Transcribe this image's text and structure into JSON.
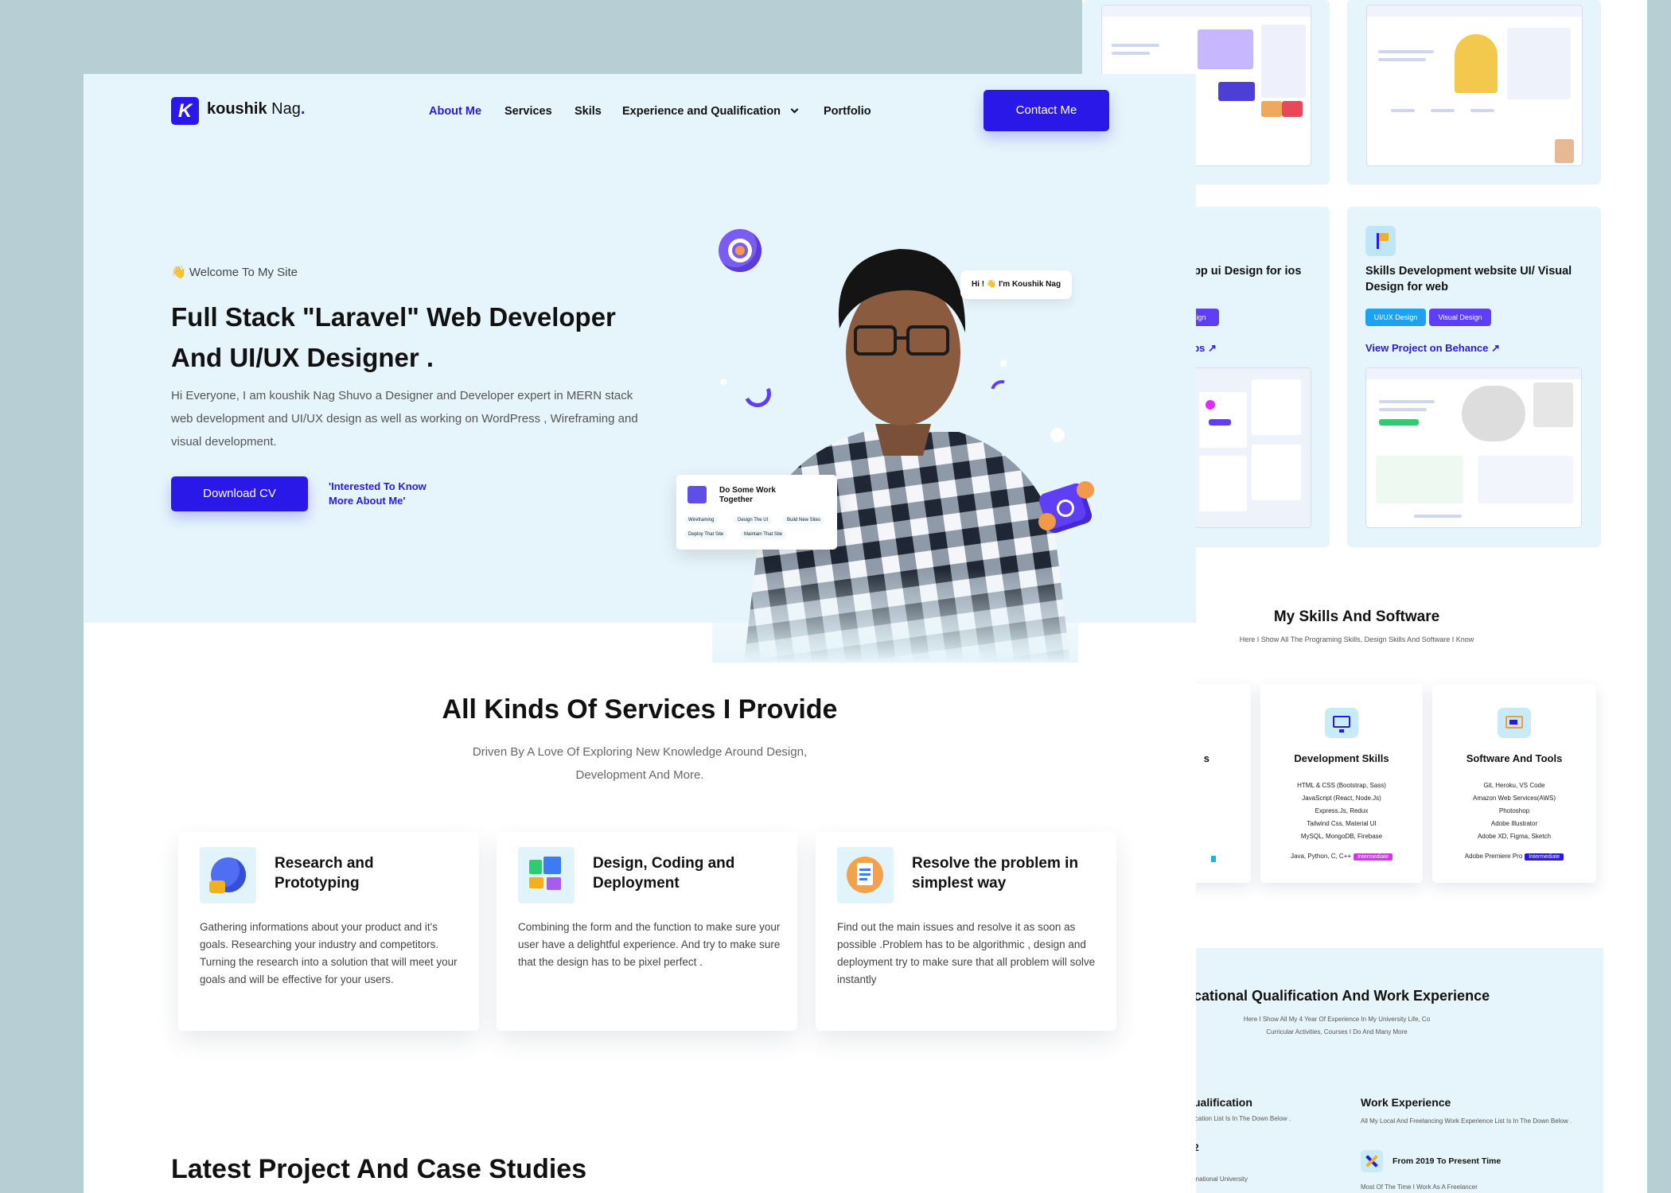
{
  "colors": {
    "accent": "#2a18e8",
    "backdrop": "#b7ced5",
    "hero_bg": "#e6f5fb"
  },
  "nav": {
    "logo_name": "koushik",
    "logo_name2": "Nag",
    "logo_dot": ".",
    "items": [
      "About Me",
      "Services",
      "Skils",
      "Experience and Qualification",
      "Portfolio"
    ],
    "contact": "Contact Me"
  },
  "hero": {
    "welcome": "👋 Welcome To My Site",
    "title": "Full Stack \"Laravel\" Web Developer And UI/UX Designer .",
    "desc": "Hi Everyone, I am koushik Nag Shuvo a Designer and Developer expert in MERN stack web development and UI/UX design as well as working on WordPress , Wireframing and visual development.",
    "download": "Download CV",
    "interest": "'Interested To Know More About Me'",
    "bubble": "Hi ! 👋 I'm Koushik Nag",
    "work_card_title": "Do Some Work Together",
    "work_chips": [
      "Wireframing",
      "Design The UI",
      "Build New Sites",
      "Deploy That Site",
      "Maintain That Site"
    ]
  },
  "services": {
    "title": "All Kinds Of Services I Provide",
    "subtitle": "Driven By A Love Of Exploring New Knowledge Around Design, Development And More.",
    "cards": [
      {
        "title": "Research and Prototyping",
        "desc": "Gathering informations about your product and it's goals. Researching your industry and competitors. Turning the research into a solution that will meet your goals and will be effective for your users."
      },
      {
        "title": "Design, Coding and Deployment",
        "desc": "Combining the form and the function to make sure your user have a delightful experience. And try to make sure that the design has to be pixel perfect ."
      },
      {
        "title": "Resolve the problem in simplest way",
        "desc": "Find out the main issues and resolve it as soon as possible .Problem has to be algorithmic , design and deployment try to make sure that all problem will solve instantly"
      }
    ]
  },
  "latest": {
    "title": "Latest Project And Case Studies"
  },
  "right": {
    "proj_left_title": "app ui Design for ios",
    "proj_left_tag": "esign",
    "proj_left_link": "abs",
    "proj_right_title": "Skills Development website UI/ Visual Design for web",
    "proj_right_tags": [
      "UI/UX Design",
      "Visual Design"
    ],
    "proj_right_link": "View Project on Behance",
    "skills_title": "My Skills And Software",
    "skills_sub": "Here I Show All The Programing Skills, Design Skills And Software I Know",
    "dev_title": "Development Skills",
    "dev_items": [
      "HTML & CSS (Bootstrap, Sass)",
      "JavaScript (React, Node.Js)",
      "Express.Js, Redux",
      "Tailwind Css, Material UI",
      "MySQL, MongoDB, Firebase"
    ],
    "dev_last": "Java, Python, C, C++",
    "dev_badge": "Intermediate",
    "sw_title": "Software And Tools",
    "sw_items": [
      "Git, Heroku, VS Code",
      "Amazon Web Services(AWS)",
      "Photoshop",
      "Adobe Illustrator",
      "Adobe XD, Figma, Sketch"
    ],
    "sw_last": "Adobe Premiere Pro",
    "sw_badge": "Intermediate",
    "partial_card_letter": "s",
    "edu_title": "cational Qualification And Work Experience",
    "edu_sub": "Here I Show All My 4 Year Of Experience In My University Life, Co Curricular Activities, Courses I Do And Many More",
    "qual_title": "ualification",
    "qual_sub": "ication List Is In The Down Below .",
    "qual_num": "2",
    "qual_uni": "rnational University",
    "work_title": "Work Experience",
    "work_sub": "All My Local And Freelancing Work Experience List Is In The Down Below .",
    "work_item": "From 2019 To Present Time",
    "work_item_sub": "Most Of The Time I Work As A Freelancer"
  }
}
